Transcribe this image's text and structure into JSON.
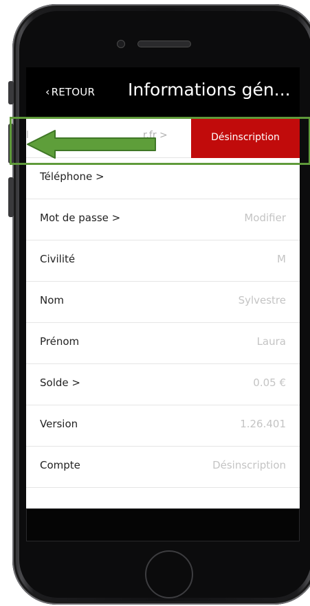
{
  "navbar": {
    "back_label": "RETOUR",
    "title": "Informations gén..."
  },
  "email_row": {
    "partial_text": "l",
    "suffix_text": "r.fr >",
    "unsubscribe_label": "Désinscription",
    "unsubscribe_color": "#c10b0b"
  },
  "rows": [
    {
      "label": "Téléphone >",
      "value": ""
    },
    {
      "label": "Mot de passe >",
      "value": "Modifier"
    },
    {
      "label": "Civilité",
      "value": "M"
    },
    {
      "label": "Nom",
      "value": "Sylvestre"
    },
    {
      "label": "Prénom",
      "value": "Laura"
    },
    {
      "label": "Solde >",
      "value": "0.05 €"
    },
    {
      "label": "Version",
      "value": "1.26.401"
    },
    {
      "label": "Compte",
      "value": "Désinscription"
    }
  ],
  "annotation": {
    "highlight_color": "#5f9a3a",
    "arrow_color": "#5e9e3a",
    "arrow_icon": "left-arrow-icon"
  }
}
